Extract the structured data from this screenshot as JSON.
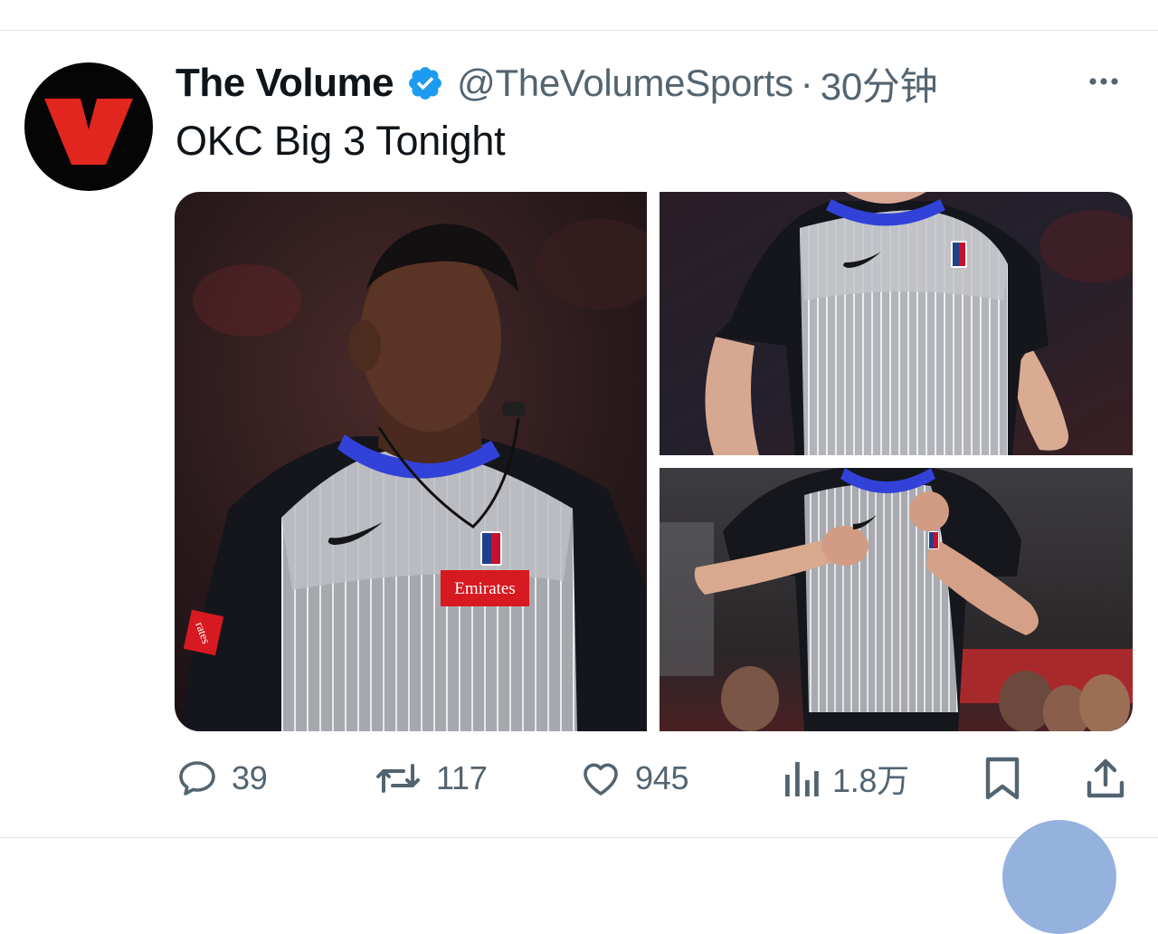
{
  "tweet": {
    "author": {
      "display_name": "The Volume",
      "handle": "@TheVolumeSports",
      "verified": true,
      "avatar_letter": "V"
    },
    "separator": "·",
    "time": "30分钟",
    "text": "OKC Big 3 Tonight",
    "media": [
      {
        "alt": "Referee with whistle in grey striped NBA shirt",
        "jersey_text": "Emirates",
        "sleeve_text": "rates"
      },
      {
        "alt": "Referee torso in grey striped NBA shirt"
      },
      {
        "alt": "Referee signaling with fists at chest"
      }
    ],
    "actions": {
      "replies": "39",
      "retweets": "117",
      "likes": "945",
      "views": "1.8万"
    }
  },
  "colors": {
    "text_primary": "#0f1419",
    "text_secondary": "#536471",
    "verified_blue": "#1d9bf0",
    "avatar_red": "#e0261f",
    "avatar_bg": "#050505",
    "divider": "#e1e5e8"
  },
  "icons": {
    "verified": "verified-badge-icon",
    "more": "more-horizontal-icon",
    "reply": "speech-bubble-icon",
    "retweet": "retweet-arrows-icon",
    "like": "heart-icon",
    "views": "bar-chart-icon",
    "bookmark": "bookmark-icon",
    "share": "share-upload-icon"
  }
}
